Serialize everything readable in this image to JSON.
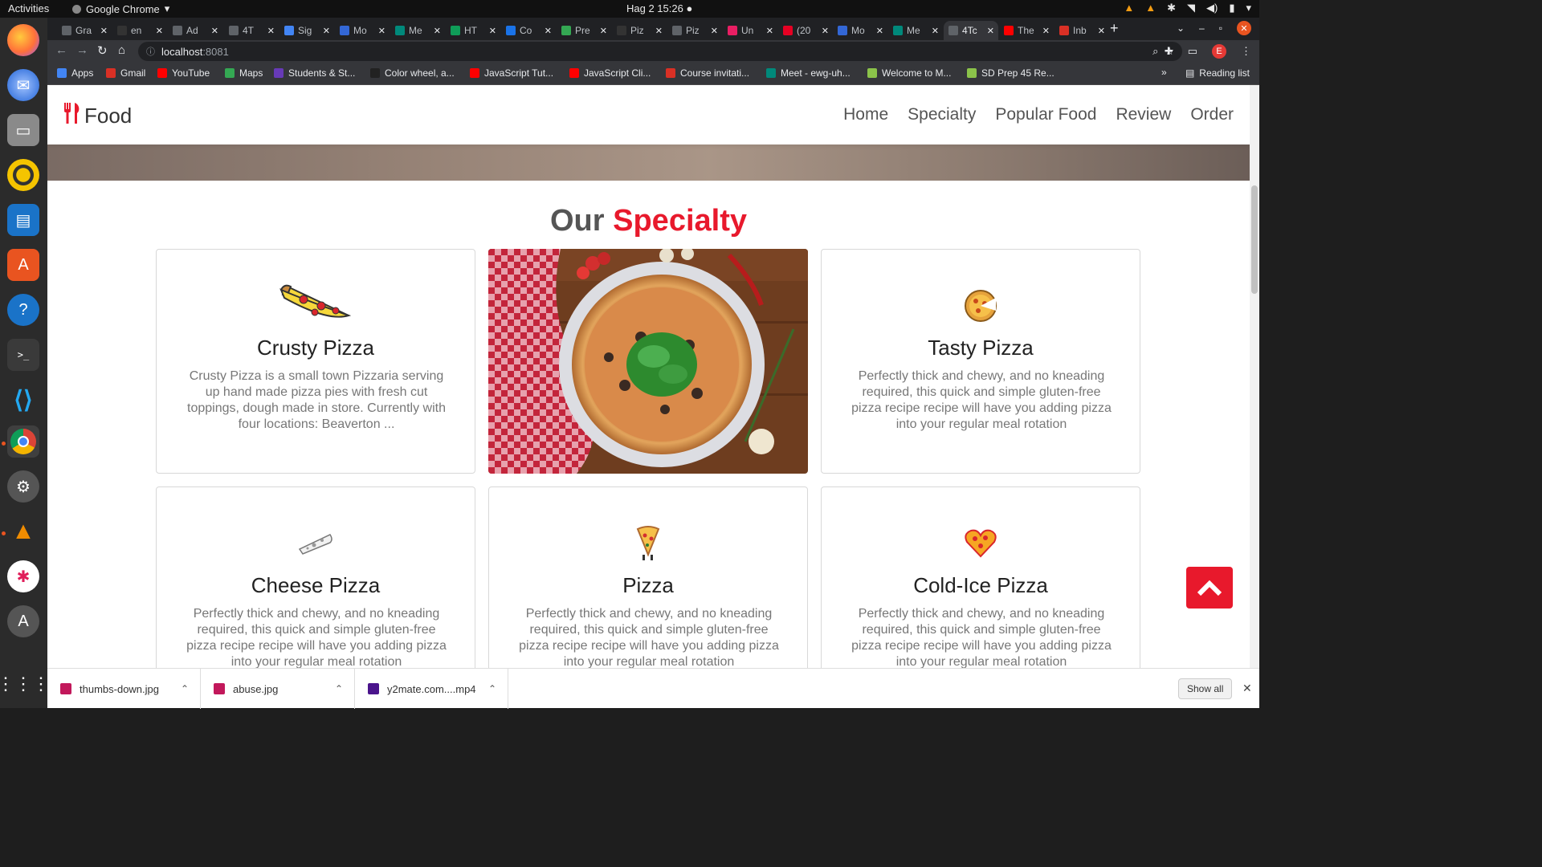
{
  "system": {
    "activities": "Activities",
    "app_name": "Google Chrome",
    "clock": "Hag 2  15:26"
  },
  "tabs": [
    {
      "label": "Gra",
      "color": "#5f6368"
    },
    {
      "label": "en",
      "color": "#333333"
    },
    {
      "label": "Ad",
      "color": "#5f6368"
    },
    {
      "label": "4T",
      "color": "#5f6368"
    },
    {
      "label": "Sig",
      "color": "#4285f4"
    },
    {
      "label": "Mo",
      "color": "#3367d6"
    },
    {
      "label": "Me",
      "color": "#00897b"
    },
    {
      "label": "HT",
      "color": "#0f9d58"
    },
    {
      "label": "Co",
      "color": "#1a73e8"
    },
    {
      "label": "Pre",
      "color": "#34a853"
    },
    {
      "label": "Piz",
      "color": "#333333"
    },
    {
      "label": "Piz",
      "color": "#5f6368"
    },
    {
      "label": "Un",
      "color": "#e91e63"
    },
    {
      "label": "(20",
      "color": "#e60023"
    },
    {
      "label": "Mo",
      "color": "#3367d6"
    },
    {
      "label": "Me",
      "color": "#00897b"
    },
    {
      "label": "4Tc",
      "color": "#5f6368",
      "active": true
    },
    {
      "label": "The",
      "color": "#ff0000"
    },
    {
      "label": "Inb",
      "color": "#d93025"
    }
  ],
  "toolbar": {
    "host": "localhost",
    "port": ":8081",
    "profile_initial": "E"
  },
  "bookmarks": [
    {
      "label": "Apps",
      "color": "#4285f4"
    },
    {
      "label": "Gmail",
      "color": "#d93025"
    },
    {
      "label": "YouTube",
      "color": "#ff0000"
    },
    {
      "label": "Maps",
      "color": "#34a853"
    },
    {
      "label": "Students & St...",
      "color": "#673ab7"
    },
    {
      "label": "Color wheel, a...",
      "color": "#222222"
    },
    {
      "label": "JavaScript Tut...",
      "color": "#ff0000"
    },
    {
      "label": "JavaScript Cli...",
      "color": "#ff0000"
    },
    {
      "label": "Course invitati...",
      "color": "#d93025"
    },
    {
      "label": "Meet - ewg-uh...",
      "color": "#00897b"
    },
    {
      "label": "Welcome to M...",
      "color": "#8bc34a"
    },
    {
      "label": "SD Prep 45 Re...",
      "color": "#8bc34a"
    }
  ],
  "bookmarks_more": "»",
  "reading_list": "Reading list",
  "site": {
    "logo_text": "Food",
    "nav": [
      "Home",
      "Specialty",
      "Popular Food",
      "Review",
      "Order"
    ],
    "section_title_plain": "Our",
    "section_title_accent": "Specialty",
    "cards": [
      {
        "title": "Crusty Pizza",
        "text": "Crusty Pizza is a small town Pizzaria serving up hand made pizza pies with fresh cut toppings, dough made in store. Currently with four locations: Beaverton ...",
        "icon": "pizza-slice-icon"
      },
      {
        "title": "Tasty Pizza",
        "text": "Perfectly thick and chewy, and no kneading required, this quick and simple gluten-free pizza recipe recipe will have you adding pizza into your regular meal rotation",
        "icon": "pizza-coin-icon"
      },
      {
        "title": "Cheese Pizza",
        "text": "Perfectly thick and chewy, and no kneading required, this quick and simple gluten-free pizza recipe recipe will have you adding pizza into your regular meal rotation",
        "icon": "cheese-slice-icon"
      },
      {
        "title": "Pizza",
        "text": "Perfectly thick and chewy, and no kneading required, this quick and simple gluten-free pizza recipe recipe will have you adding pizza into your regular meal rotation",
        "icon": "pizza-character-icon"
      },
      {
        "title": "Cold-Ice Pizza",
        "text": "Perfectly thick and chewy, and no kneading required, this quick and simple gluten-free pizza recipe recipe will have you adding pizza into your regular meal rotation",
        "icon": "heart-pizza-icon"
      }
    ],
    "accent_color": "#e8192c"
  },
  "downloads": [
    {
      "file": "thumbs-down.jpg",
      "color": "#c2185b"
    },
    {
      "file": "abuse.jpg",
      "color": "#c2185b"
    },
    {
      "file": "y2mate.com....mp4",
      "color": "#4a148c"
    }
  ],
  "show_all": "Show all"
}
